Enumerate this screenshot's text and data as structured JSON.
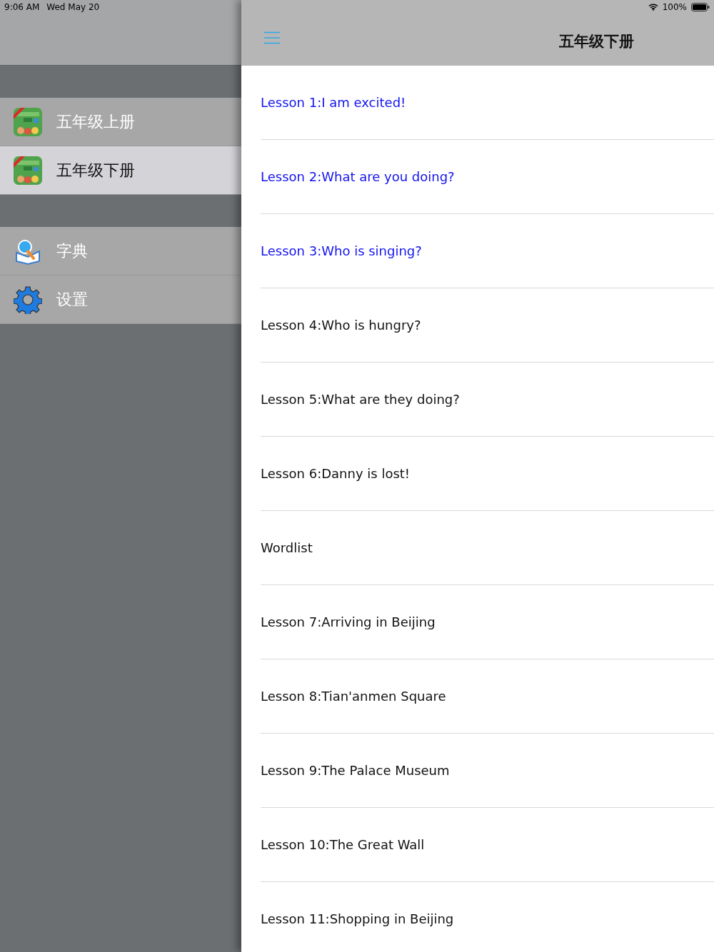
{
  "status_bar": {
    "time": "9:06 AM",
    "date": "Wed May 20",
    "battery": "100%"
  },
  "sidebar": {
    "groups": [
      {
        "items": [
          {
            "kind": "book",
            "label": "五年级上册",
            "selected": false
          },
          {
            "kind": "book",
            "label": "五年级下册",
            "selected": true
          }
        ]
      },
      {
        "items": [
          {
            "kind": "dictionary",
            "label": "字典",
            "selected": false
          },
          {
            "kind": "settings",
            "label": "设置",
            "selected": false
          }
        ]
      }
    ]
  },
  "header": {
    "title": "五年级下册"
  },
  "lessons": [
    {
      "title": "Lesson 1:I am excited!",
      "highlighted": true
    },
    {
      "title": "Lesson 2:What are you doing?",
      "highlighted": true
    },
    {
      "title": "Lesson 3:Who is singing?",
      "highlighted": true
    },
    {
      "title": "Lesson 4:Who is hungry?",
      "highlighted": false
    },
    {
      "title": "Lesson 5:What are they doing?",
      "highlighted": false
    },
    {
      "title": "Lesson 6:Danny is lost!",
      "highlighted": false
    },
    {
      "title": "Wordlist",
      "highlighted": false
    },
    {
      "title": "Lesson 7:Arriving in Beijing",
      "highlighted": false
    },
    {
      "title": "Lesson 8:Tian'anmen Square",
      "highlighted": false
    },
    {
      "title": "Lesson 9:The Palace Museum",
      "highlighted": false
    },
    {
      "title": "Lesson 10:The Great Wall",
      "highlighted": false
    },
    {
      "title": "Lesson 11:Shopping in Beijing",
      "highlighted": false
    }
  ]
}
